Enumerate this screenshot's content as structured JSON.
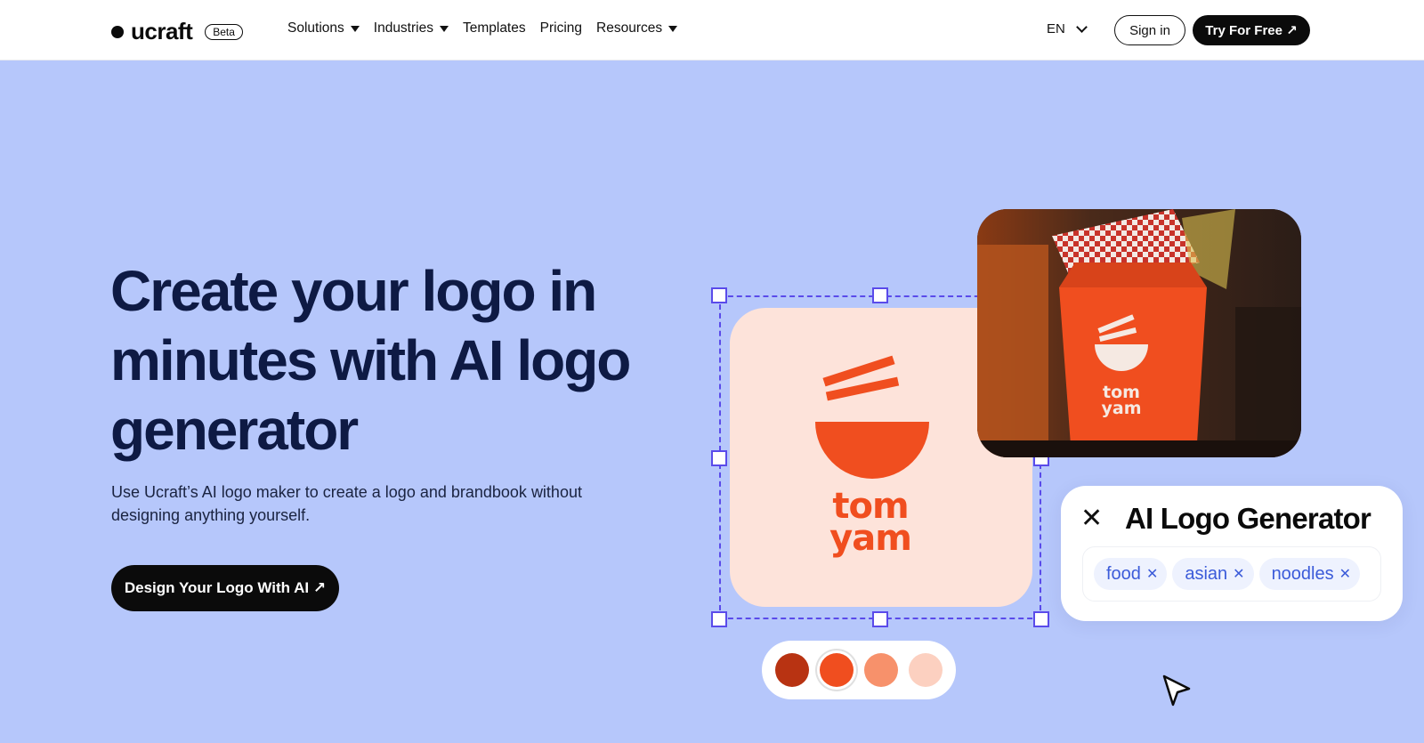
{
  "header": {
    "brand": "ucraft",
    "badge": "Beta",
    "nav": [
      {
        "label": "Solutions"
      },
      {
        "label": "Industries"
      },
      {
        "label": "Templates"
      },
      {
        "label": "Pricing"
      },
      {
        "label": "Resources"
      }
    ],
    "language": "EN",
    "sign_in": "Sign in",
    "try_free": "Try For Free ↗"
  },
  "hero": {
    "title": "Create your logo in minutes with AI logo generator",
    "subtitle": "Use Ucraft’s AI logo maker to create a logo and brandbook without designing anything yourself.",
    "cta": "Design Your Logo With AI ↗"
  },
  "illustration": {
    "logo_word_1": "tom",
    "logo_word_2": "yam",
    "box_word_1": "tom",
    "box_word_2": "yam",
    "generator_title": "AI Logo Generator",
    "tags": [
      {
        "label": "food"
      },
      {
        "label": "asian"
      },
      {
        "label": "noodles"
      }
    ],
    "palette": [
      "#b83312",
      "#f04e1f",
      "#f7916b",
      "#fcd0c0"
    ]
  },
  "colors": {
    "background": "#b6c7fb",
    "accent": "#f04e1f",
    "selection": "#5a4bea",
    "button": "#0b0b0b"
  }
}
